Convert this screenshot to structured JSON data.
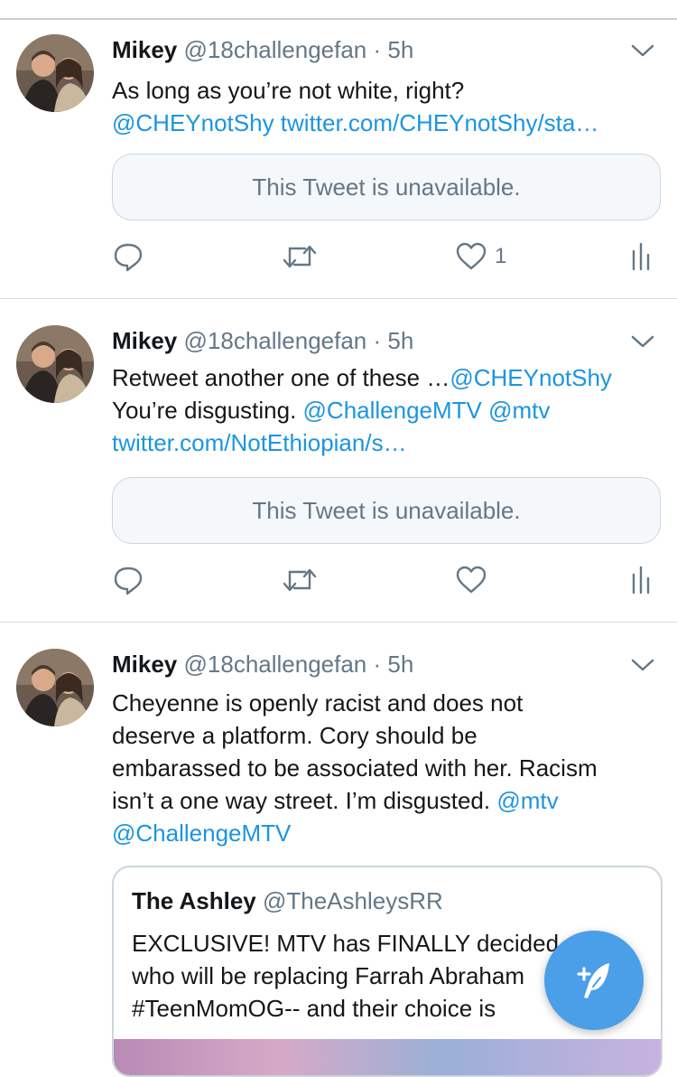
{
  "tweets": [
    {
      "name": "Mikey",
      "handle": "@18challengefan",
      "sep": "·",
      "time": "5h",
      "lines": [
        [
          {
            "t": "As long as you’re not white, right?",
            "link": false
          }
        ],
        [
          {
            "t": "@CHEYnotShy twitter.com/CHEYnotShy/sta…",
            "link": true
          }
        ]
      ],
      "unavailable": "This Tweet is unavailable.",
      "like_count": "1"
    },
    {
      "name": "Mikey",
      "handle": "@18challengefan",
      "sep": "·",
      "time": "5h",
      "lines": [
        [
          {
            "t": "Retweet another one of these …",
            "link": false
          },
          {
            "t": "@CHEYnotShy",
            "link": true
          }
        ],
        [
          {
            "t": "You’re disgusting. ",
            "link": false
          },
          {
            "t": "@ChallengeMTV @mtv",
            "link": true
          }
        ],
        [
          {
            "t": "twitter.com/NotEthiopian/s…",
            "link": true
          }
        ]
      ],
      "unavailable": "This Tweet is unavailable.",
      "like_count": ""
    },
    {
      "name": "Mikey",
      "handle": "@18challengefan",
      "sep": "·",
      "time": "5h",
      "lines": [
        [
          {
            "t": "Cheyenne is openly racist and does not",
            "link": false
          }
        ],
        [
          {
            "t": "deserve a platform.  Cory should be",
            "link": false
          }
        ],
        [
          {
            "t": "embarassed to be associated with her.  Racism",
            "link": false
          }
        ],
        [
          {
            "t": "isn’t a one way street. I’m disgusted. ",
            "link": false
          },
          {
            "t": "@mtv",
            "link": true
          }
        ],
        [
          {
            "t": "@ChallengeMTV",
            "link": true
          }
        ]
      ],
      "quote": {
        "name": "The Ashley",
        "handle": "@TheAshleysRR",
        "lines": [
          "EXCLUSIVE! MTV has FINALLY decided",
          "who will be replacing Farrah Abraham",
          "#TeenMomOG-- and their choice is"
        ]
      }
    }
  ],
  "icons": {
    "reply": "reply-icon",
    "retweet": "retweet-icon",
    "like": "heart-icon",
    "analytics": "analytics-icon",
    "menu": "chevron-down-icon",
    "compose": "compose-tweet-icon"
  },
  "colors": {
    "link": "#1b95e0",
    "secondary": "#657786",
    "fab": "#4a9fe8"
  }
}
